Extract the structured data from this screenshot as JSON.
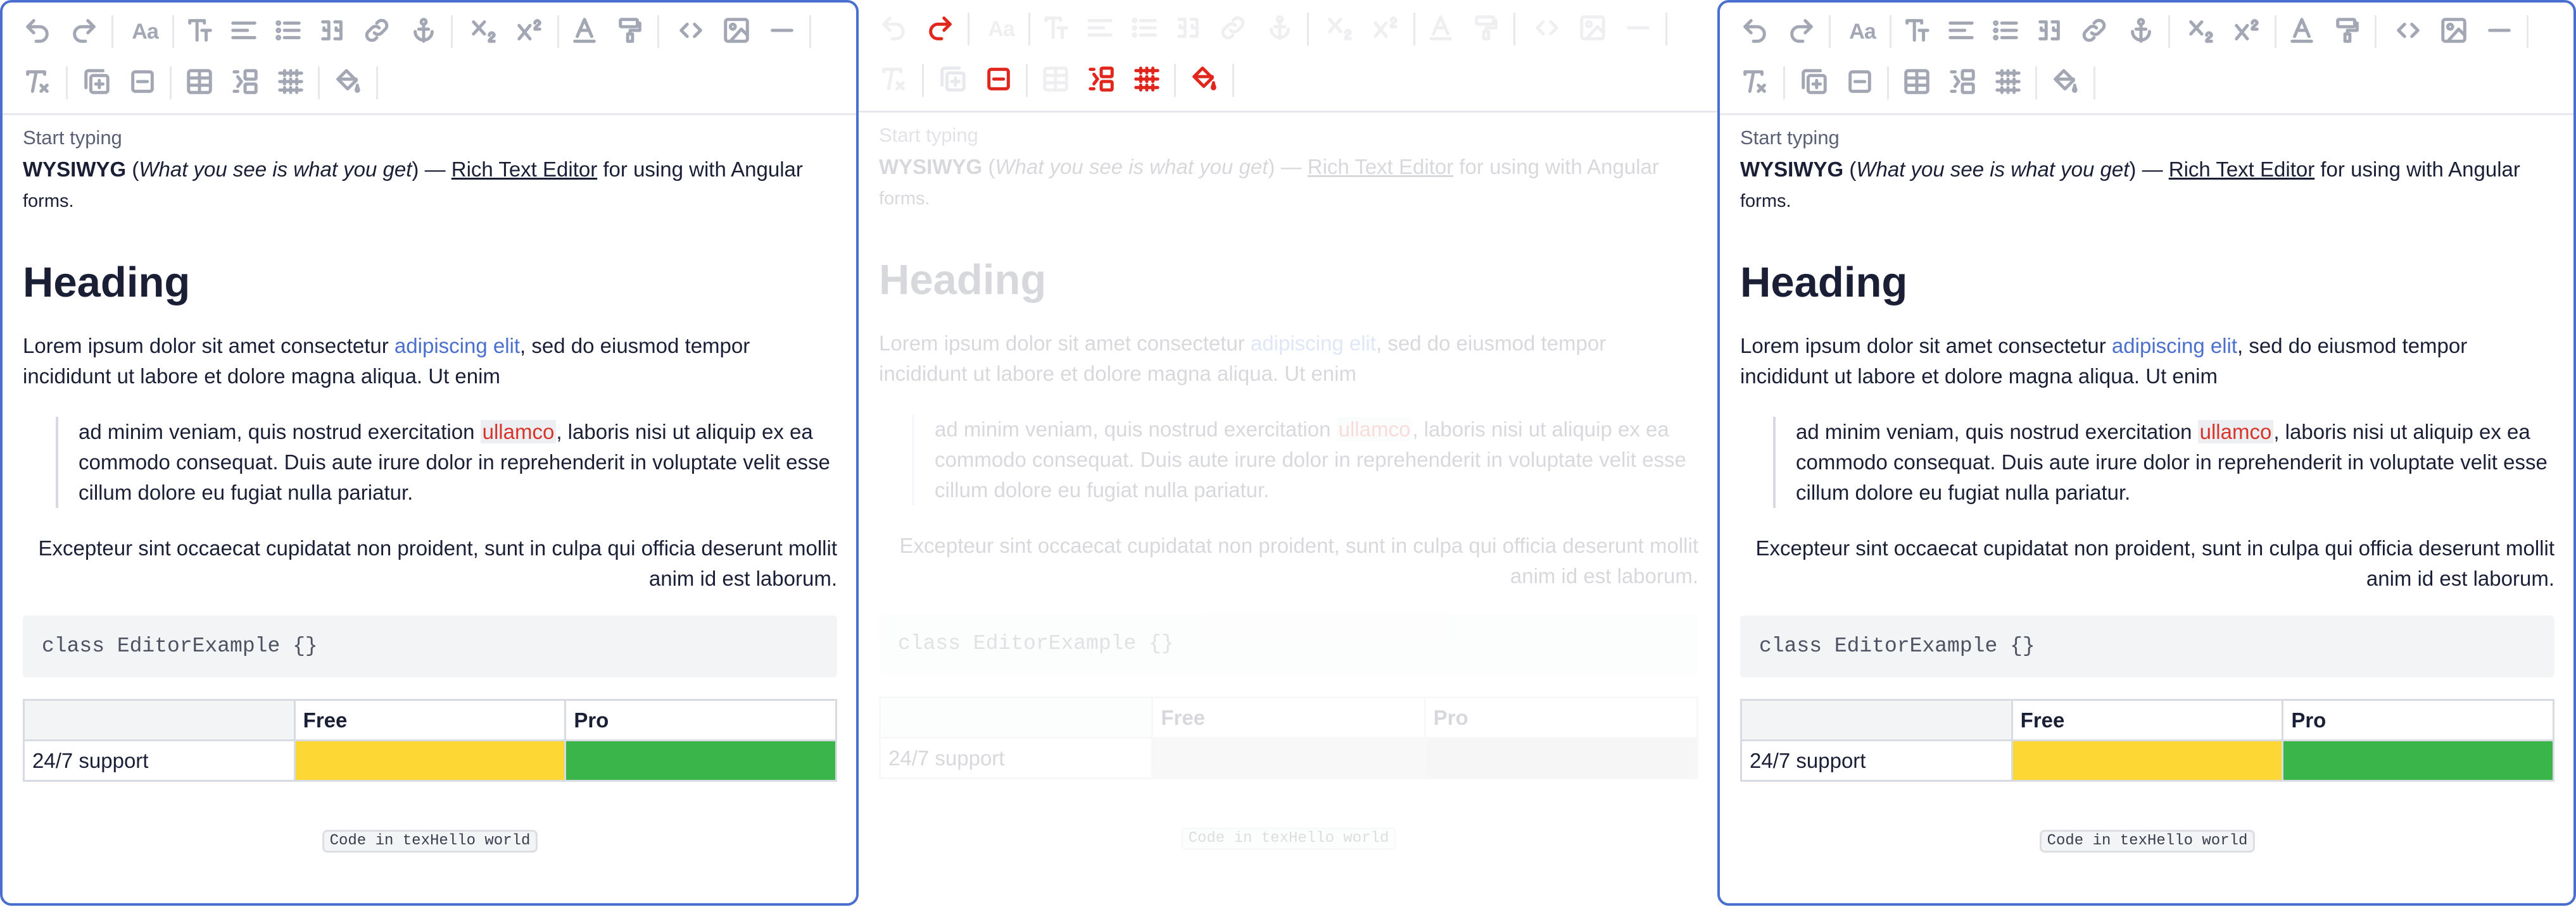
{
  "editor": {
    "placeholder": "Start typing",
    "intro": {
      "bold": "WYSIWYG",
      "open_paren": " (",
      "italic": "What you see is what you get",
      "close": ") — ",
      "underline": "Rich Text Editor",
      "rest": " for using with Angular",
      "small": "forms."
    },
    "heading": "Heading",
    "paragraph": {
      "before_link": "Lorem ipsum dolor sit amet consectetur ",
      "link": "adipiscing elit",
      "after_link": ", sed do eiusmod tempor incididunt ut labore et dolore magna aliqua. Ut enim"
    },
    "quote": {
      "before_mark": "ad minim veniam, quis nostrud exercitation ",
      "mark": "ullamco",
      "after_mark": ", laboris nisi ut aliquip ex ea commodo consequat. Duis aute irure dolor in reprehenderit in voluptate velit esse cillum dolore eu fugiat nulla pariatur."
    },
    "right_paragraph": "Excepteur sint occaecat cupidatat non proident, sunt in culpa qui officia deserunt mollit anim id est laborum.",
    "code_block": "class EditorExample {}",
    "table": {
      "headers": [
        "",
        "Free",
        "Pro"
      ],
      "rows": [
        {
          "label": "24/7 support",
          "free_color": "#fdd835",
          "pro_color": "#3ab54a"
        }
      ]
    },
    "inline_code": "Code in texHello world"
  },
  "toolbar": {
    "font_size_label": "Aa",
    "icons": [
      "undo-icon",
      "redo-icon",
      "font-size-icon",
      "text-style-icon",
      "align-icon",
      "list-icon",
      "blockquote-icon",
      "link-icon",
      "anchor-icon",
      "subscript-icon",
      "superscript-icon",
      "text-color-icon",
      "format-paint-icon",
      "code-icon",
      "image-icon",
      "horizontal-rule-icon",
      "clear-format-icon",
      "insert-row-icon",
      "delete-row-icon",
      "table-icon",
      "merge-cells-icon",
      "split-cells-icon",
      "cell-color-icon"
    ]
  },
  "colors": {
    "accent": "#4a6fce",
    "active_red": "#e0261d",
    "mark_red": "#d8352a",
    "yellow": "#fdd835",
    "green": "#3ab54a"
  }
}
